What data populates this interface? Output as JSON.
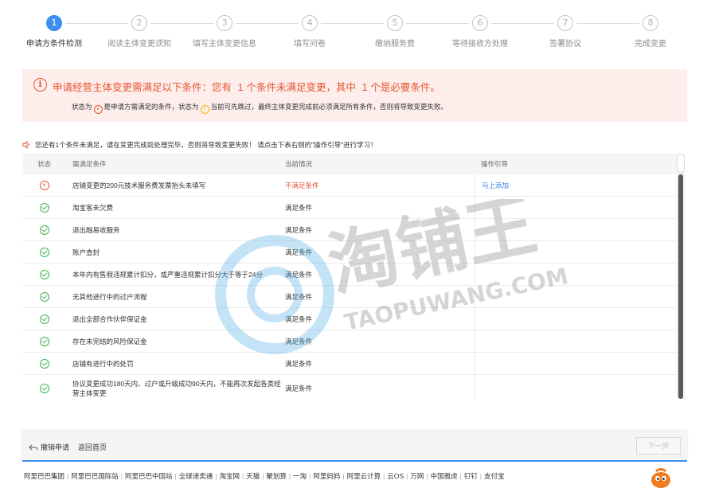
{
  "steps": [
    {
      "num": "1",
      "label": "申请方条件检测"
    },
    {
      "num": "2",
      "label": "阅读主体变更须知"
    },
    {
      "num": "3",
      "label": "填写主体变更信息"
    },
    {
      "num": "4",
      "label": "填写问卷"
    },
    {
      "num": "5",
      "label": "缴纳服务费"
    },
    {
      "num": "6",
      "label": "等待接收方处理"
    },
    {
      "num": "7",
      "label": "签署协议"
    },
    {
      "num": "8",
      "label": "完成变更"
    }
  ],
  "active_step": 1,
  "banner": {
    "title_prefix": "申请经营主体变更需满足以下条件：您有",
    "unmet_count": "1",
    "title_mid": "个条件未满足变更，其中",
    "required_count": "1",
    "title_suffix": "个是必要条件。",
    "desc_a": "状态为",
    "desc_b": "是申请方需满足的条件，状态为",
    "desc_c": "当前可先跳过，最终主体变更完成前必须满足所有条件，否则将导致变更失败。"
  },
  "notice": "您还有1个条件未满足，请在变更完成前处理完毕，否则将导致变更失败！ 请点击下表右侧的\"操作引导\"进行学习！",
  "table": {
    "headers": [
      "状态",
      "需满足条件",
      "当前情况",
      "操作引导"
    ],
    "rows": [
      {
        "status": "fail",
        "condition": "店铺变更的200元技术服务费发票抬头未填写",
        "current": "不满足条件",
        "action": "马上添加"
      },
      {
        "status": "ok",
        "condition": "淘宝客未欠费",
        "current": "满足条件",
        "action": ""
      },
      {
        "status": "ok",
        "condition": "退出融易收服务",
        "current": "满足条件",
        "action": ""
      },
      {
        "status": "ok",
        "condition": "账户查封",
        "current": "满足条件",
        "action": ""
      },
      {
        "status": "ok",
        "condition": "本年内有售假违规累计扣分，或严重违规累计扣分大于等于24分",
        "current": "满足条件",
        "action": ""
      },
      {
        "status": "ok",
        "condition": "无其他进行中的过户流程",
        "current": "满足条件",
        "action": ""
      },
      {
        "status": "ok",
        "condition": "退出全部合作伙伴保证金",
        "current": "满足条件",
        "action": ""
      },
      {
        "status": "ok",
        "condition": "存在未完结的风险保证金",
        "current": "满足条件",
        "action": ""
      },
      {
        "status": "ok",
        "condition": "店铺有进行中的处罚",
        "current": "满足条件",
        "action": ""
      },
      {
        "status": "ok",
        "condition": "协议变更成功180天内、过户或升级成功90天内，不能再次发起各类经营主体变更",
        "current": "满足条件",
        "action": ""
      }
    ]
  },
  "watermark": {
    "brand": "淘铺王",
    "domain": "TAOPUWANG.COM"
  },
  "footer": {
    "undo": "撤销申请",
    "home": "返回首页",
    "next": "下一步"
  },
  "links": [
    "阿里巴巴集团",
    "阿里巴巴国际站",
    "阿里巴巴中国站",
    "全球速卖通",
    "淘宝网",
    "天猫",
    "聚划算",
    "一淘",
    "阿里妈妈",
    "阿里云计算",
    "云OS",
    "万网",
    "中国雅虎",
    "钉钉",
    "支付宝"
  ],
  "colors": {
    "accent": "#3d8ef0",
    "error": "#e8542f",
    "ok": "#3fb34f",
    "warn": "#f4b400"
  }
}
